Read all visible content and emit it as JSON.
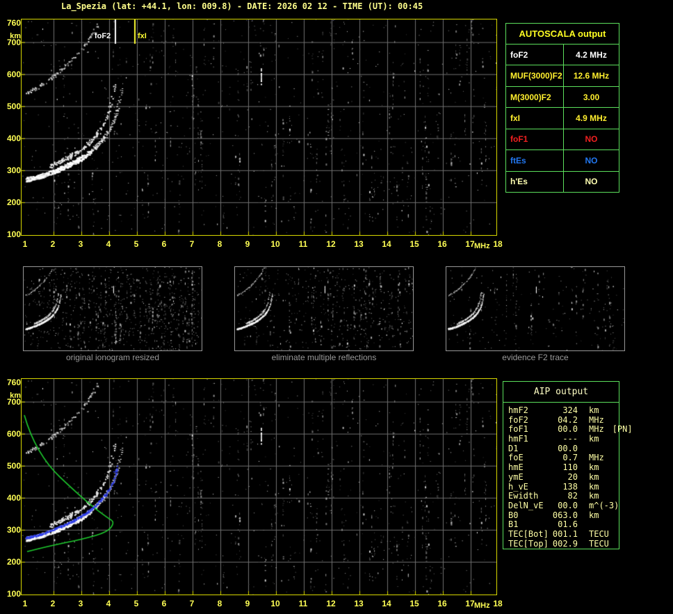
{
  "title": "La_Spezia (lat: +44.1, lon: 009.8) - DATE: 2026 02 12 - TIME (UT): 00:45",
  "colors": {
    "accent_yellow": "#ffff55",
    "border_yellow": "#d9d900",
    "grid_gray": "#707070",
    "table_green": "#5ce05c",
    "pale_yellow": "#ffffa6",
    "bright_yellow": "#ffef2e",
    "white": "#ffffff",
    "status_red": "#f02020",
    "status_blue": "#2277f0",
    "green_profile": "#1ecc2e",
    "blue_trace": "#2f3fe8",
    "caption_gray": "#9a9a9a"
  },
  "autoscala_table": {
    "header": "AUTOSCALA output",
    "rows": [
      {
        "label": "foF2",
        "value": "4.2 MHz",
        "color": "#ffffff"
      },
      {
        "label": "MUF(3000)F2",
        "value": "12.6 MHz",
        "color": "#ffef2e"
      },
      {
        "label": "M(3000)F2",
        "value": "3.00",
        "color": "#ffef2e"
      },
      {
        "label": "fxI",
        "value": "4.9 MHz",
        "color": "#ffef2e"
      },
      {
        "label": "foF1",
        "value": "NO",
        "color": "#f02020"
      },
      {
        "label": "ftEs",
        "value": "NO",
        "color": "#2277f0"
      },
      {
        "label": "h'Es",
        "value": "NO",
        "color": "#fdfdb0"
      }
    ]
  },
  "thumbnails": [
    {
      "caption": "original ionogram resized",
      "noise": 1.0
    },
    {
      "caption": "eliminate multiple reflections",
      "noise": 0.65
    },
    {
      "caption": "evidence F2 trace",
      "noise": 0.28
    }
  ],
  "aip_table": {
    "header": "AIP output",
    "rows": [
      {
        "label": "hmF2",
        "value": "324",
        "unit": "km",
        "extra": ""
      },
      {
        "label": "foF2",
        "value": "04.2",
        "unit": "MHz",
        "extra": ""
      },
      {
        "label": "foF1",
        "value": "00.0",
        "unit": "MHz",
        "extra": "[PN]"
      },
      {
        "label": "hmF1",
        "value": "---",
        "unit": "km",
        "extra": ""
      },
      {
        "label": "D1",
        "value": "00.0",
        "unit": "",
        "extra": ""
      },
      {
        "label": "foE",
        "value": "0.7",
        "unit": "MHz",
        "extra": ""
      },
      {
        "label": "hmE",
        "value": "110",
        "unit": "km",
        "extra": ""
      },
      {
        "label": "ymE",
        "value": "20",
        "unit": "km",
        "extra": ""
      },
      {
        "label": "h_vE",
        "value": "138",
        "unit": "km",
        "extra": ""
      },
      {
        "label": "Ewidth",
        "value": "82",
        "unit": "km",
        "extra": ""
      },
      {
        "label": "DelN_vE",
        "value": "00.0",
        "unit": "m^(-3)",
        "extra": ""
      },
      {
        "label": "B0",
        "value": "063.0",
        "unit": "km",
        "extra": ""
      },
      {
        "label": "B1",
        "value": "01.6",
        "unit": "",
        "extra": ""
      },
      {
        "label": "TEC[Bot]",
        "value": "001.1",
        "unit": "TECU",
        "extra": ""
      },
      {
        "label": "TEC[Top]",
        "value": "002.9",
        "unit": "TECU",
        "extra": ""
      }
    ]
  },
  "chart_data": [
    {
      "id": "top-ionogram",
      "type": "scatter",
      "title": "raw ionogram with autoscaled characteristics",
      "xlabel": "MHz",
      "ylabel": "km",
      "xlim": [
        1,
        18
      ],
      "ylim": [
        100,
        760
      ],
      "x_ticks": [
        1,
        2,
        3,
        4,
        5,
        6,
        7,
        8,
        9,
        10,
        11,
        12,
        13,
        14,
        15,
        16,
        17,
        18
      ],
      "y_ticks": [
        760,
        700,
        600,
        500,
        400,
        300,
        200,
        100
      ],
      "grid": true,
      "annotations": [
        {
          "label": "foF2",
          "x_mhz": 4.2,
          "color": "#ffffff"
        },
        {
          "label": "fxI",
          "x_mhz": 4.9,
          "color": "#ffff33"
        }
      ],
      "f2_trace_f_km": [
        [
          1.0,
          272
        ],
        [
          1.4,
          279
        ],
        [
          1.8,
          291
        ],
        [
          2.2,
          305
        ],
        [
          2.6,
          321
        ],
        [
          3.0,
          340
        ],
        [
          3.4,
          364
        ],
        [
          3.7,
          390
        ],
        [
          3.9,
          412
        ],
        [
          4.05,
          432
        ],
        [
          4.15,
          452
        ],
        [
          4.22,
          472
        ],
        [
          4.28,
          492
        ],
        [
          4.33,
          512
        ],
        [
          4.37,
          532
        ],
        [
          4.42,
          552
        ]
      ],
      "second_hop_multiple": 2,
      "echo_dash": {
        "f_mhz": 9.45,
        "km_range": [
          568,
          618
        ]
      }
    },
    {
      "id": "bottom-ionogram",
      "type": "scatter",
      "title": "ionogram with AIP restored trace and electron density profile",
      "xlabel": "MHz",
      "ylabel": "km",
      "xlim": [
        1,
        18
      ],
      "ylim": [
        100,
        760
      ],
      "x_ticks": [
        1,
        2,
        3,
        4,
        5,
        6,
        7,
        8,
        9,
        10,
        11,
        12,
        13,
        14,
        15,
        16,
        17,
        18
      ],
      "y_ticks": [
        760,
        700,
        600,
        500,
        400,
        300,
        200,
        100
      ],
      "grid": true,
      "profile_green_f_km": [
        [
          0.95,
          658
        ],
        [
          1.15,
          597
        ],
        [
          1.8,
          500
        ],
        [
          2.65,
          430
        ],
        [
          3.35,
          376
        ],
        [
          3.95,
          337
        ],
        [
          4.2,
          324
        ],
        [
          3.95,
          293
        ],
        [
          3.05,
          271
        ],
        [
          1.9,
          250
        ],
        [
          1.05,
          232
        ]
      ],
      "restored_trace_blue_f_km": [
        [
          1.0,
          272
        ],
        [
          1.4,
          279
        ],
        [
          1.8,
          291
        ],
        [
          2.2,
          305
        ],
        [
          2.6,
          321
        ],
        [
          3.0,
          340
        ],
        [
          3.4,
          364
        ],
        [
          3.7,
          390
        ],
        [
          3.9,
          412
        ],
        [
          4.05,
          432
        ],
        [
          4.15,
          452
        ],
        [
          4.22,
          472
        ],
        [
          4.3,
          495
        ]
      ],
      "blue_cross_f_km": [
        4.22,
        482
      ]
    }
  ]
}
